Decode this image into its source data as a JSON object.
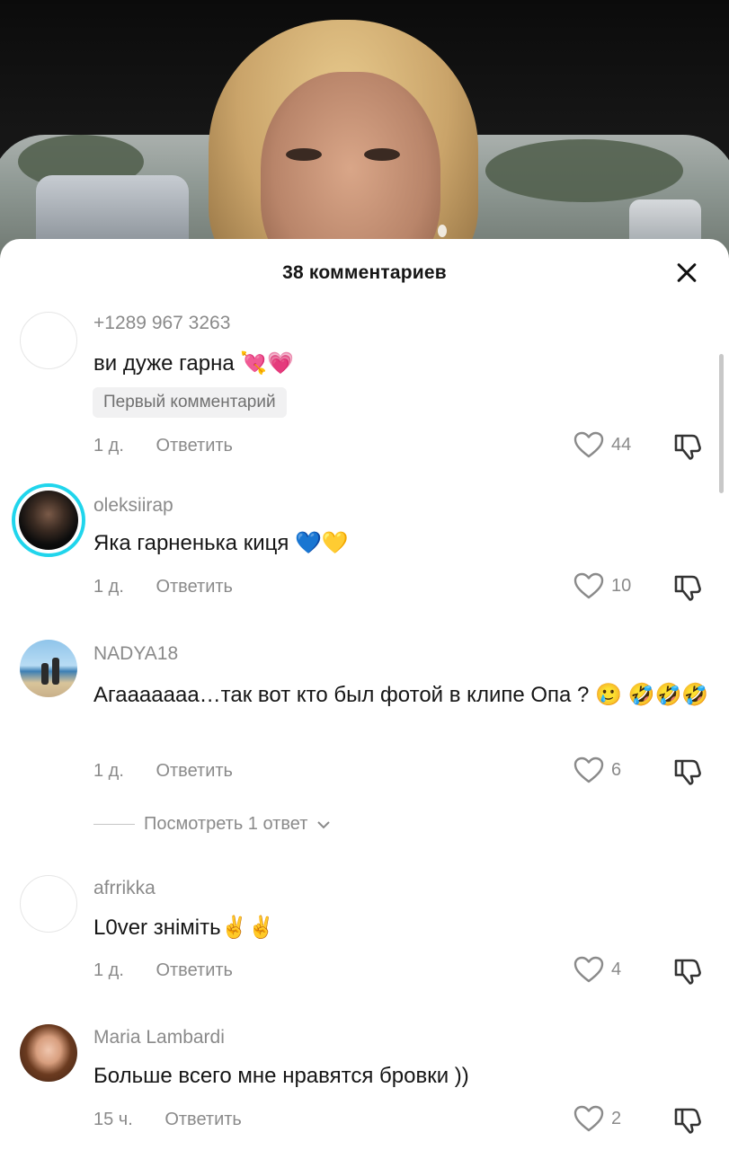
{
  "sheet": {
    "title": "38 комментариев"
  },
  "comments": [
    {
      "username": "+1289 967 3263",
      "text": "ви дуже гарна 💘💗",
      "badge": "Первый комментарий",
      "time": "1 д.",
      "reply_label": "Ответить",
      "likes": "44",
      "avatar": "blank"
    },
    {
      "username": "oleksiirap",
      "text": "Яка гарненька киця 💙💛",
      "time": "1 д.",
      "reply_label": "Ответить",
      "likes": "10",
      "avatar": "story-ring"
    },
    {
      "username": "NADYA18",
      "text": "Агааааааа…так вот кто был фотой в клипе Опа ? 🥲 🤣🤣🤣",
      "time": "1 д.",
      "reply_label": "Ответить",
      "likes": "6",
      "view_replies": "Посмотреть 1 ответ",
      "avatar": "beach-photo"
    },
    {
      "username": "afrrikka",
      "text": "L0ver зніміть✌️✌️",
      "time": "1 д.",
      "reply_label": "Ответить",
      "likes": "4",
      "avatar": "blank"
    },
    {
      "username": "Maria Lambardi",
      "text": "Больше всего мне нравятся бровки ))",
      "time": "15 ч.",
      "reply_label": "Ответить",
      "likes": "2",
      "avatar": "portrait-photo"
    }
  ],
  "icons": {
    "close": "close-icon",
    "like": "heart-outline-icon",
    "dislike": "thumbs-down-icon",
    "expand": "chevron-down-icon"
  },
  "colors": {
    "story_ring": "#20d5ec",
    "secondary_text": "#8a8a8a",
    "badge_bg": "#f1f1f2"
  }
}
